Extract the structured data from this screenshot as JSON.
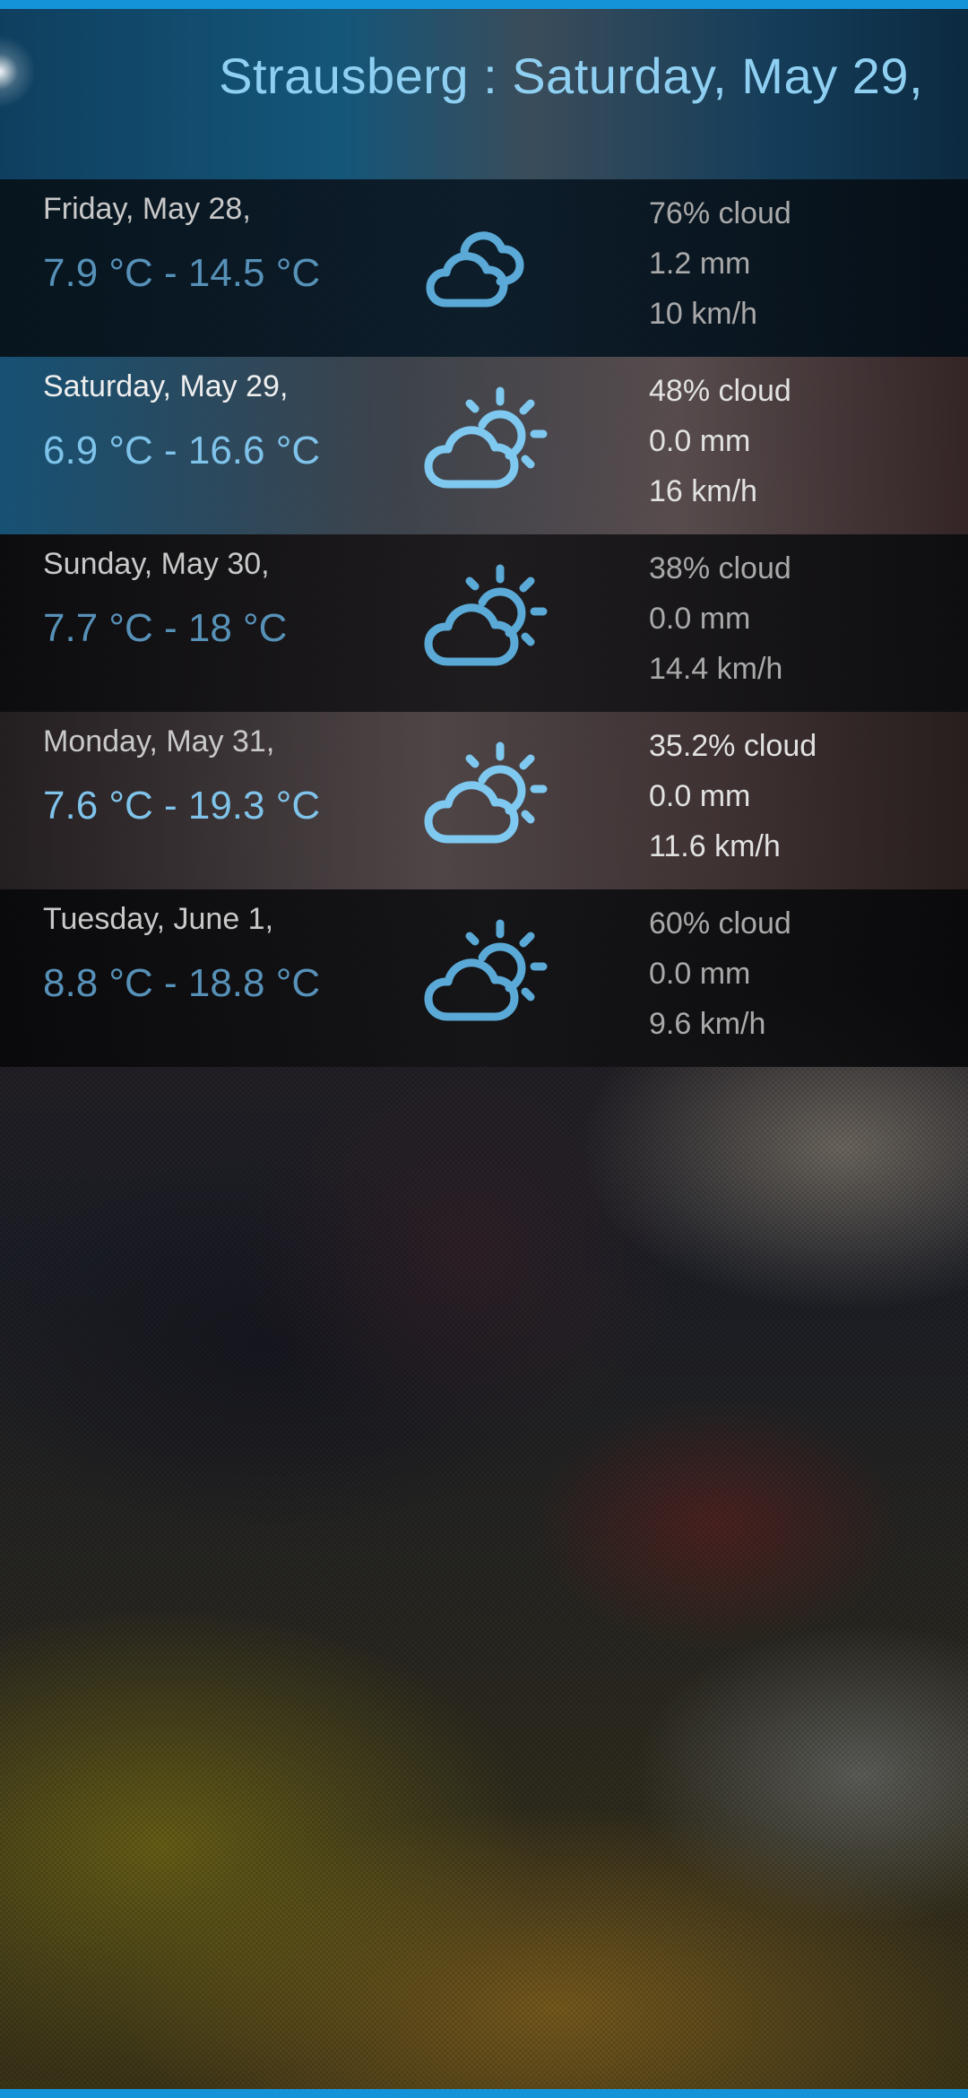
{
  "header": {
    "title": "Strausberg : Saturday, May 29,"
  },
  "colors": {
    "accent_bar": "#1593d8",
    "title_text": "#8fd0f2",
    "temp_text": "#5a9bc6",
    "icon_stroke": "#5aa9d6"
  },
  "forecast": [
    {
      "date": "Friday, May 28,",
      "temperature": "7.9 °C  - 14.5 °C",
      "icon": "cloudy-icon",
      "cloud": "76% cloud",
      "precipitation": "1.2 mm",
      "wind": "10 km/h"
    },
    {
      "date": "Saturday, May 29,",
      "temperature": "6.9 °C  - 16.6 °C",
      "icon": "partly-sunny-icon",
      "cloud": "48% cloud",
      "precipitation": "0.0 mm",
      "wind": "16 km/h"
    },
    {
      "date": "Sunday, May 30,",
      "temperature": "7.7 °C  - 18 °C",
      "icon": "partly-sunny-icon",
      "cloud": "38% cloud",
      "precipitation": "0.0 mm",
      "wind": "14.4 km/h"
    },
    {
      "date": "Monday, May 31,",
      "temperature": "7.6 °C  - 19.3 °C",
      "icon": "partly-sunny-icon",
      "cloud": "35.2% cloud",
      "precipitation": "0.0 mm",
      "wind": "11.6 km/h"
    },
    {
      "date": "Tuesday, June 1,",
      "temperature": "8.8 °C  - 18.8 °C",
      "icon": "partly-sunny-icon",
      "cloud": "60% cloud",
      "precipitation": "0.0 mm",
      "wind": "9.6 km/h"
    }
  ]
}
